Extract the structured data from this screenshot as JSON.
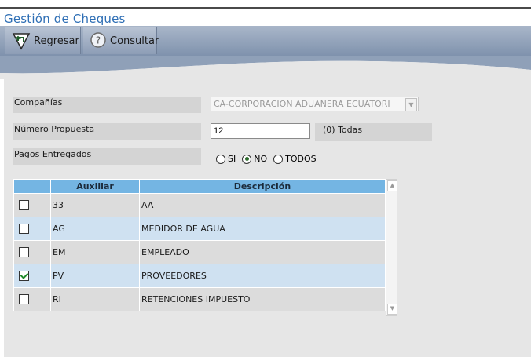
{
  "page": {
    "title": "Gestión de Cheques"
  },
  "toolbar": {
    "back_label": "Regresar",
    "query_label": "Consultar"
  },
  "form": {
    "company_label": "Compañías",
    "company_value": "CA-CORPORACION ADUANERA ECUATORI",
    "proposal_label": "Número Propuesta",
    "proposal_value": "12",
    "proposal_hint": "(0) Todas",
    "payments_label": "Pagos Entregados",
    "payments_options": [
      "SI",
      "NO",
      "TODOS"
    ],
    "payments_selected": "NO"
  },
  "table": {
    "columns": [
      "",
      "Auxiliar",
      "Descripción"
    ],
    "rows": [
      {
        "checked": false,
        "aux": "33",
        "desc": "AA"
      },
      {
        "checked": false,
        "aux": "AG",
        "desc": "MEDIDOR DE AGUA"
      },
      {
        "checked": false,
        "aux": "EM",
        "desc": "EMPLEADO"
      },
      {
        "checked": true,
        "aux": "PV",
        "desc": "PROVEEDORES"
      },
      {
        "checked": false,
        "aux": "RI",
        "desc": "RETENCIONES IMPUESTO"
      }
    ]
  }
}
